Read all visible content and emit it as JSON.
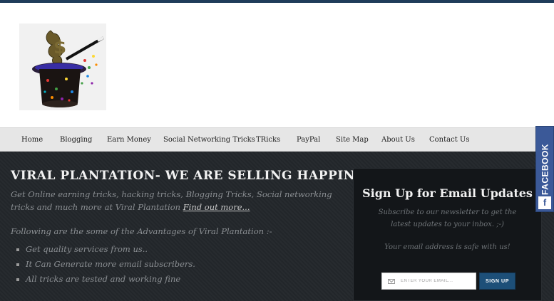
{
  "nav": {
    "items": [
      {
        "label": "Home"
      },
      {
        "label": "Blogging"
      },
      {
        "label": "Earn Money"
      },
      {
        "label": "Social Networking Tricks"
      },
      {
        "label": "TRicks"
      },
      {
        "label": "PayPal"
      },
      {
        "label": "Site Map"
      },
      {
        "label": "About Us"
      },
      {
        "label": "Contact Us"
      }
    ]
  },
  "hero": {
    "title": "VIRAL PLANTATION- WE ARE SELLING HAPPINESS",
    "text": "Get Online earning tricks, hacking tricks, Blogging Tricks, Social networking tricks and much more at Viral Plantation",
    "link_label": "Find out more...",
    "advantages_title": "Following are the some of the Advantages of Viral Plantation :-",
    "advantages": [
      "Get quality services from us..",
      "It Can Generate more email subscribers.",
      "All tricks are tested and working fine"
    ]
  },
  "signup": {
    "title": "Sign Up for Email Updates",
    "subtitle": "Subscribe to our newsletter to get the latest updates to your inbox. ;-)",
    "safe_note": "Your email address is safe with us!",
    "email_placeholder": "ENTER YOUR EMAIL...",
    "button_label": "SIGN UP"
  },
  "facebook_tab": {
    "label": "FACEBOOK",
    "icon_glyph": "f"
  },
  "colors": {
    "topbar": "#1f3c5a",
    "main_bg": "#23272b",
    "signup_bg": "#131619",
    "button": "#1d4f78",
    "facebook": "#3b5998"
  }
}
